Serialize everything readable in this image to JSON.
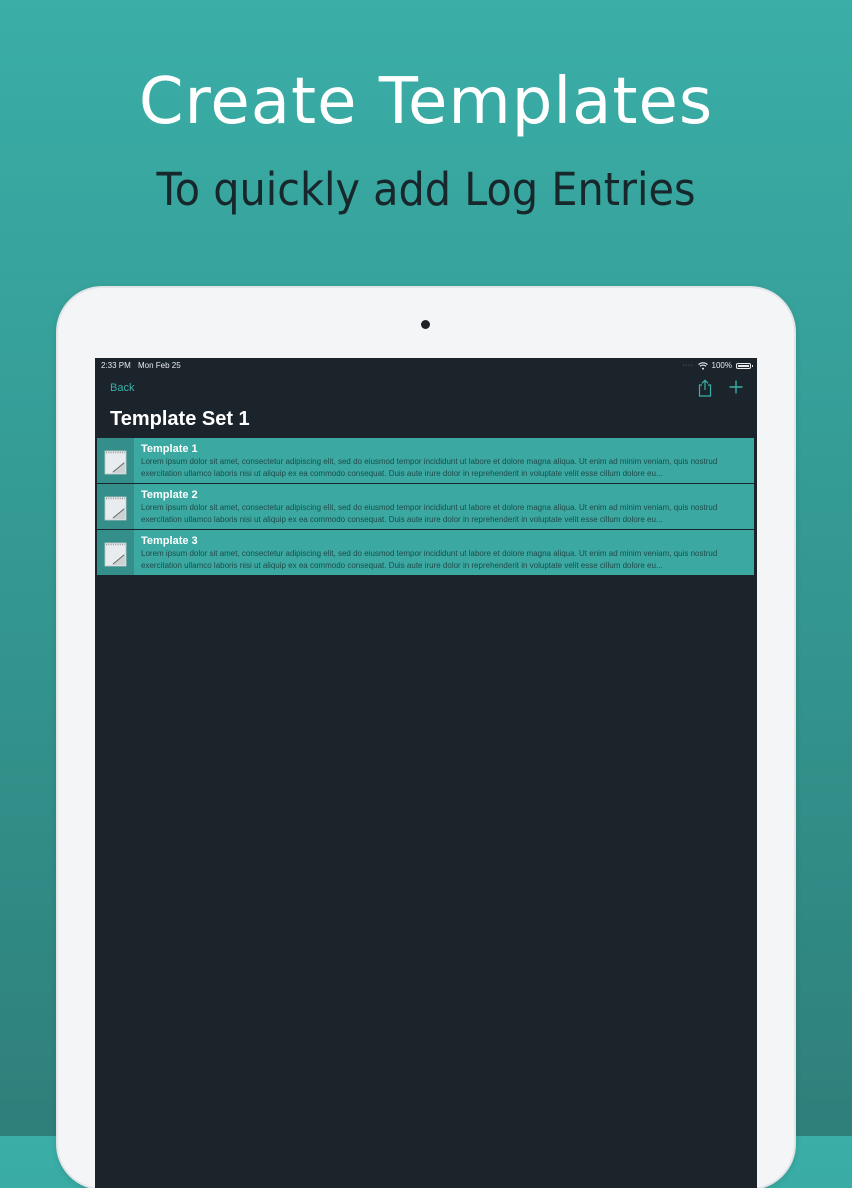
{
  "hero": {
    "title": "Create Templates",
    "subtitle": "To quickly add Log Entries"
  },
  "status_bar": {
    "time": "2:33 PM",
    "date": "Mon Feb 25",
    "battery": "100%"
  },
  "nav": {
    "back_label": "Back",
    "share_icon": "share-icon",
    "add_icon": "plus-icon"
  },
  "page": {
    "title": "Template Set 1"
  },
  "templates": [
    {
      "title": "Template 1",
      "body": "Lorem ipsum dolor sit amet, consectetur adipiscing elit, sed do eiusmod tempor incididunt ut labore et dolore magna aliqua. Ut enim ad minim veniam, quis nostrud exercitation ullamco laboris nisi ut aliquip ex ea commodo consequat. Duis aute irure dolor in reprehenderit in voluptate velit esse cillum dolore eu..."
    },
    {
      "title": "Template 2",
      "body": "Lorem ipsum dolor sit amet, consectetur adipiscing elit, sed do eiusmod tempor incididunt ut labore et dolore magna aliqua. Ut enim ad minim veniam, quis nostrud exercitation ullamco laboris nisi ut aliquip ex ea commodo consequat. Duis aute irure dolor in reprehenderit in voluptate velit esse cillum dolore eu..."
    },
    {
      "title": "Template 3",
      "body": "Lorem ipsum dolor sit amet, consectetur adipiscing elit, sed do eiusmod tempor incididunt ut labore et dolore magna aliqua. Ut enim ad minim veniam, quis nostrud exercitation ullamco laboris nisi ut aliquip ex ea commodo consequat. Duis aute irure dolor in reprehenderit in voluptate velit esse cillum dolore eu..."
    }
  ],
  "colors": {
    "accent": "#3bb0a8",
    "row_background": "#3ba9a1",
    "screen_background": "#1c242b",
    "page_gradient_top": "#3aaea7",
    "page_gradient_bottom": "#2f7f7b"
  }
}
